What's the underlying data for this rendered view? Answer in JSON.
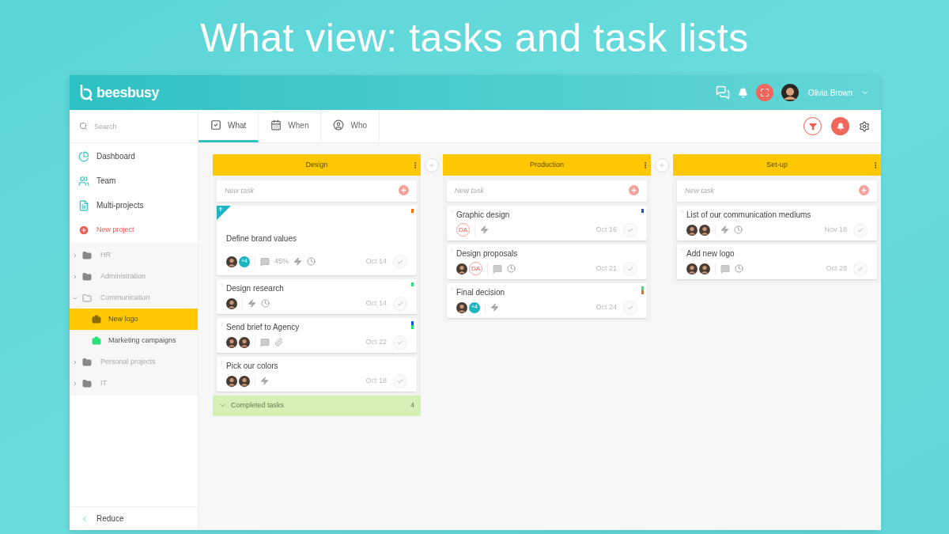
{
  "headline": "What view: tasks and task lists",
  "app": {
    "logo": "beesbusy",
    "user": "Olivia Brown"
  },
  "sidebar": {
    "search": {
      "placeholder": "Search"
    },
    "nav": [
      {
        "label": "Dashboard",
        "kind": "dashboard"
      },
      {
        "label": "Team",
        "kind": "team"
      },
      {
        "label": "Multi-projects",
        "kind": "multi"
      },
      {
        "label": "New project",
        "kind": "new"
      }
    ],
    "projects": [
      {
        "label": "HR",
        "expanded": false
      },
      {
        "label": "Administration",
        "expanded": false
      },
      {
        "label": "Communication",
        "expanded": true,
        "children": [
          {
            "label": "New logo",
            "selected": true,
            "color": "#8a6d00"
          },
          {
            "label": "Marketing campaigns",
            "selected": false,
            "color": "#2ee07a"
          }
        ]
      },
      {
        "label": "Personal projects",
        "expanded": false
      },
      {
        "label": "IT",
        "expanded": false
      }
    ],
    "reduce": "Reduce"
  },
  "tabs": [
    {
      "label": "What",
      "kind": "what",
      "selected": true
    },
    {
      "label": "When",
      "kind": "when",
      "selected": false
    },
    {
      "label": "Who",
      "kind": "who",
      "selected": false
    }
  ],
  "columns": [
    {
      "title": "Design",
      "new_task": {
        "placeholder": "New task"
      },
      "tasks": [
        {
          "title": "Define brand values",
          "flagged": true,
          "date": "Oct 14",
          "markers": [
            {
              "color": "#ff6a00"
            }
          ],
          "people": [
            {
              "kind": "photo"
            },
            {
              "kind": "more",
              "text": "+4"
            }
          ],
          "meta": [
            {
              "kind": "comment"
            },
            {
              "kind": "progress",
              "text": "45%"
            },
            {
              "kind": "bolt"
            },
            {
              "kind": "clock"
            }
          ]
        },
        {
          "title": "Design research",
          "flagged": false,
          "date": "Oct 14",
          "markers": [
            {
              "color": "#2ee07a"
            }
          ],
          "people": [
            {
              "kind": "photo"
            }
          ],
          "meta": [
            {
              "kind": "bolt"
            },
            {
              "kind": "clock"
            }
          ]
        },
        {
          "title": "Send brief to Agency",
          "flagged": false,
          "date": "Oct 22",
          "markers": [
            {
              "color": "#1e4fe0"
            },
            {
              "color": "#2ee07a"
            }
          ],
          "people": [
            {
              "kind": "photo"
            },
            {
              "kind": "photo"
            }
          ],
          "meta": [
            {
              "kind": "comment"
            },
            {
              "kind": "attach"
            }
          ]
        },
        {
          "title": "Pick our colors",
          "flagged": false,
          "date": "Oct 18",
          "people": [
            {
              "kind": "photo"
            },
            {
              "kind": "photo"
            }
          ],
          "meta": [
            {
              "kind": "bolt"
            }
          ]
        }
      ],
      "completed": {
        "label": "Completed tasks",
        "count": "4"
      }
    },
    {
      "title": "Production",
      "new_task": {
        "placeholder": "New task"
      },
      "tasks": [
        {
          "title": "Graphic design",
          "flagged": false,
          "date": "Oct 16",
          "markers": [
            {
              "color": "#1e4fe0"
            }
          ],
          "people": [
            {
              "kind": "initials",
              "text": "DA"
            }
          ],
          "meta": [
            {
              "kind": "bolt"
            }
          ]
        },
        {
          "title": "Design proposals",
          "flagged": false,
          "date": "Oct 21",
          "people": [
            {
              "kind": "photo"
            },
            {
              "kind": "initials",
              "text": "DA"
            }
          ],
          "meta": [
            {
              "kind": "comment"
            },
            {
              "kind": "clock"
            }
          ]
        },
        {
          "title": "Final decision",
          "flagged": false,
          "date": "Oct 24",
          "markers": [
            {
              "color": "#2ee07a"
            },
            {
              "color": "#ff6a00"
            }
          ],
          "people": [
            {
              "kind": "photo"
            },
            {
              "kind": "more",
              "text": "+4"
            }
          ],
          "meta": [
            {
              "kind": "bolt"
            }
          ]
        }
      ]
    },
    {
      "title": "Set-up",
      "new_task": {
        "placeholder": "New task"
      },
      "tasks": [
        {
          "title": "List of our communication mediums",
          "flagged": false,
          "date": "Nov 18",
          "people": [
            {
              "kind": "photo"
            },
            {
              "kind": "photo"
            }
          ],
          "meta": [
            {
              "kind": "bolt"
            },
            {
              "kind": "clock"
            }
          ]
        },
        {
          "title": "Add new logo",
          "flagged": false,
          "date": "Oct 28",
          "people": [
            {
              "kind": "photo"
            },
            {
              "kind": "photo"
            }
          ],
          "meta": [
            {
              "kind": "comment"
            },
            {
              "kind": "clock"
            }
          ]
        }
      ]
    }
  ]
}
